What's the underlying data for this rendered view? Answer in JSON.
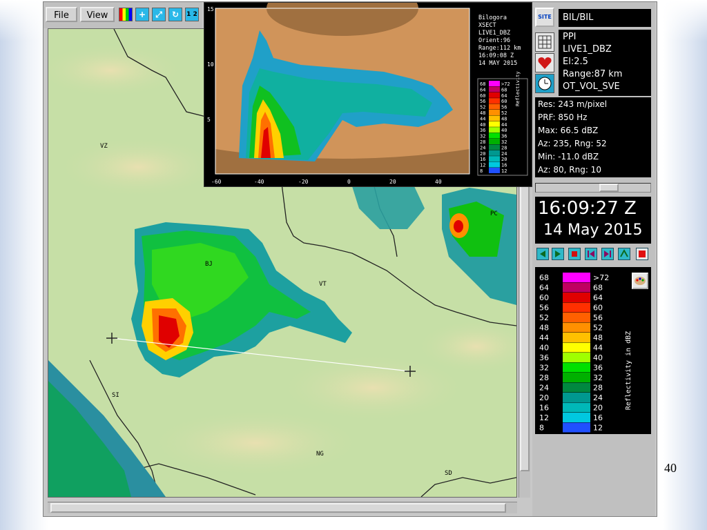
{
  "menu": {
    "file_label": "File",
    "view_label": "View"
  },
  "toolbar": {
    "icons": [
      "palette-icon",
      "crosshair-icon",
      "zoom-icon",
      "refresh-icon",
      "pages-icon"
    ],
    "pages_label": "1 2"
  },
  "xsect": {
    "info_lines": [
      "Bilogora",
      "XSECT",
      "LIVE1_DBZ",
      "Orient:96",
      "Range:112 km",
      "16:09:08 Z",
      "14 MAY 2015"
    ],
    "x_ticks": [
      "-60",
      "-40",
      "-20",
      "0",
      "20",
      "40"
    ],
    "y_ticks": [
      "15",
      "10",
      "5"
    ],
    "legend_title": "Reflectivity",
    "legend_rows": [
      {
        "lo": "68",
        "hi": ">72",
        "color": "#ff00ff"
      },
      {
        "lo": "64",
        "hi": "68",
        "color": "#c00060"
      },
      {
        "lo": "60",
        "hi": "64",
        "color": "#e00000"
      },
      {
        "lo": "56",
        "hi": "60",
        "color": "#ff3000"
      },
      {
        "lo": "52",
        "hi": "56",
        "color": "#ff6000"
      },
      {
        "lo": "48",
        "hi": "52",
        "color": "#ff9000"
      },
      {
        "lo": "44",
        "hi": "48",
        "color": "#ffc000"
      },
      {
        "lo": "40",
        "hi": "44",
        "color": "#ffff00"
      },
      {
        "lo": "36",
        "hi": "40",
        "color": "#a0ff00"
      },
      {
        "lo": "32",
        "hi": "36",
        "color": "#00e000"
      },
      {
        "lo": "28",
        "hi": "32",
        "color": "#00b000"
      },
      {
        "lo": "24",
        "hi": "28",
        "color": "#008840"
      },
      {
        "lo": "20",
        "hi": "24",
        "color": "#009890"
      },
      {
        "lo": "16",
        "hi": "20",
        "color": "#00b8b8"
      },
      {
        "lo": "12",
        "hi": "16",
        "color": "#00c8e0"
      },
      {
        "lo": "8",
        "hi": "12",
        "color": "#2050ff"
      }
    ]
  },
  "map": {
    "labels": [
      "VZ",
      "BJ",
      "VT",
      "PC",
      "SI",
      "NG",
      "SD"
    ]
  },
  "panel": {
    "site_icon_label": "SITE",
    "site_name": "BIL/BIL",
    "product_lines": [
      "PPI",
      "LIVE1_DBZ",
      "El:2.5",
      "Range:87 km",
      "OT_VOL_SVE"
    ],
    "stats_lines": [
      "Res: 243 m/pixel",
      "PRF: 850 Hz",
      "Max: 66.5 dBZ",
      "Az:  235, Rng: 52",
      "Min: -11.0 dBZ",
      "Az:  80, Rng: 10"
    ],
    "time": "16:09:27 Z",
    "date": "14 May 2015",
    "controls": [
      "rewind-icon",
      "play-icon",
      "stop-icon",
      "step-back-icon",
      "step-forward-icon",
      "loop-icon",
      "record-icon"
    ],
    "legend_title": "Reflectivity in dBZ"
  },
  "slide": {
    "page_number": "40"
  }
}
